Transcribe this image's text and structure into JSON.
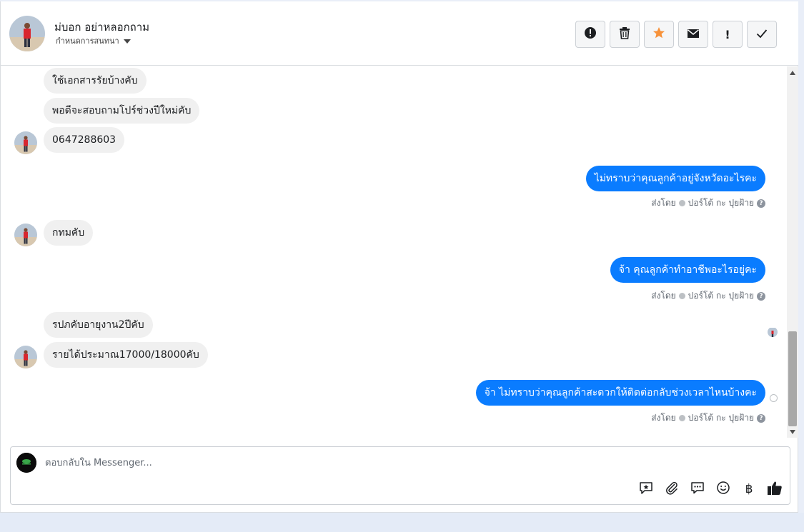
{
  "header": {
    "contact_name": "ม่บอก อย่าหลอกถาม",
    "status_label": "กำหนดการสนทนา"
  },
  "actions": [
    {
      "icon": "alert-circle-icon"
    },
    {
      "icon": "trash-icon"
    },
    {
      "icon": "star-icon",
      "color": "#f7923a"
    },
    {
      "icon": "mail-icon"
    },
    {
      "icon": "exclamation-icon",
      "label": "!"
    },
    {
      "icon": "check-icon"
    }
  ],
  "messages": [
    {
      "direction": "in",
      "text": "ใช้เอกสารรัยบ้างคับ"
    },
    {
      "direction": "in",
      "text": "พอดีจะสอบถามโปร์ช่วงปีใหม่คับ"
    },
    {
      "direction": "in",
      "text": "0647288603"
    },
    {
      "direction": "out",
      "text": "ไม่ทราบว่าคุณลูกค้าอยู่จังหวัดอะไรคะ",
      "sent_by": "ส่งโดย",
      "sender": "ปอร์โต้ กะ ปุยฝ้าย"
    },
    {
      "direction": "in",
      "text": "กทมคับ"
    },
    {
      "direction": "out",
      "text": "จ้า คุณลูกค้าทำอาชีพอะไรอยู่คะ",
      "sent_by": "ส่งโดย",
      "sender": "ปอร์โต้ กะ ปุยฝ้าย"
    },
    {
      "direction": "in",
      "text": "รปภคับอายุงาน2ปีคับ"
    },
    {
      "direction": "in",
      "text": "รายได้ประมาณ17000/18000คับ"
    },
    {
      "direction": "out",
      "text": "จ้า  ไม่ทราบว่าคุณลูกค้าสะดวกให้ติดต่อกลับช่วงเวลาไหนบ้างคะ",
      "sent_by": "ส่งโดย",
      "sender": "ปอร์โต้ กะ ปุยฝ้าย"
    }
  ],
  "composer": {
    "placeholder": "ตอบกลับใน Messenger..."
  },
  "composer_tools": [
    "saved-reply-icon",
    "paperclip-icon",
    "chat-bubbles-icon",
    "emoji-icon",
    "baht-icon",
    "thumbs-up-icon"
  ],
  "colors": {
    "accent": "#0a7cff",
    "incoming_bubble": "#f0f0f0",
    "star": "#f7923a"
  },
  "baht_symbol": "฿"
}
